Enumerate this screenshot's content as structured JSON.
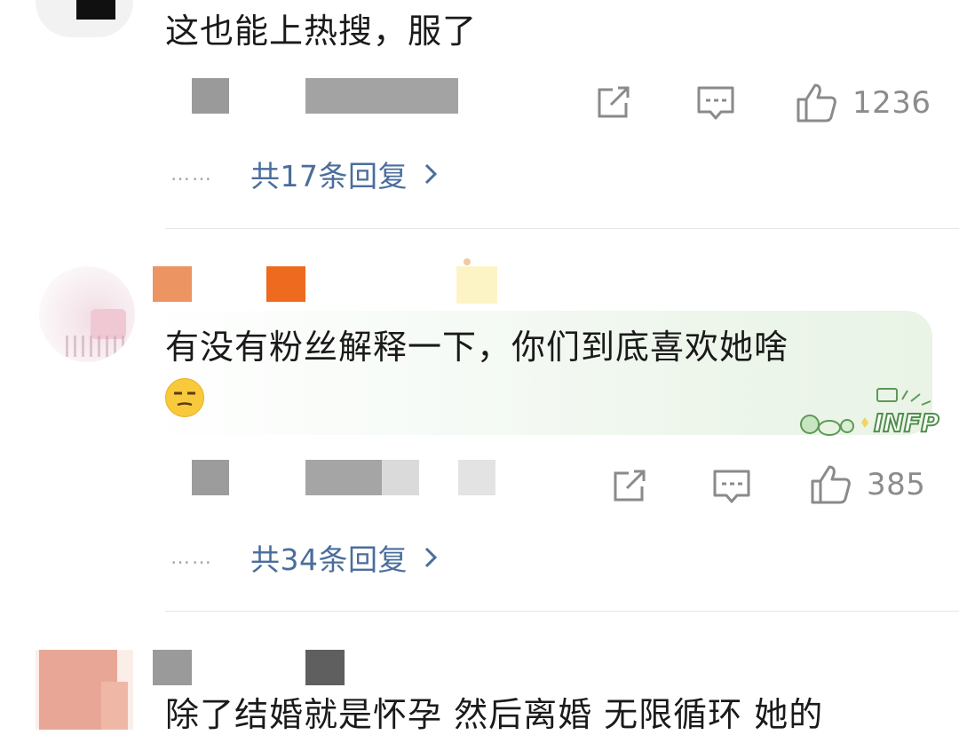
{
  "comments": [
    {
      "text": "这也能上热搜，服了",
      "actions": {
        "like_count": "1236"
      },
      "replies_label": "共17条回复",
      "replies_dots": "……"
    },
    {
      "text": "有没有粉丝解释一下，你们到底喜欢她啥",
      "emoji": "unamused-face-emoji",
      "badge_text": "INFP",
      "actions": {
        "like_count": "385"
      },
      "replies_label": "共34条回复",
      "replies_dots": "……"
    },
    {
      "text": "除了结婚就是怀孕 然后离婚 无限循环 她的"
    }
  ],
  "icons": {
    "share": "share-icon",
    "comment": "comment-icon",
    "like": "thumbs-up-icon",
    "chevron": "chevron-right-icon"
  },
  "colors": {
    "reply_link": "#4a6d9c",
    "action_gray": "#8a8a8a",
    "text": "#1a1a1a"
  }
}
